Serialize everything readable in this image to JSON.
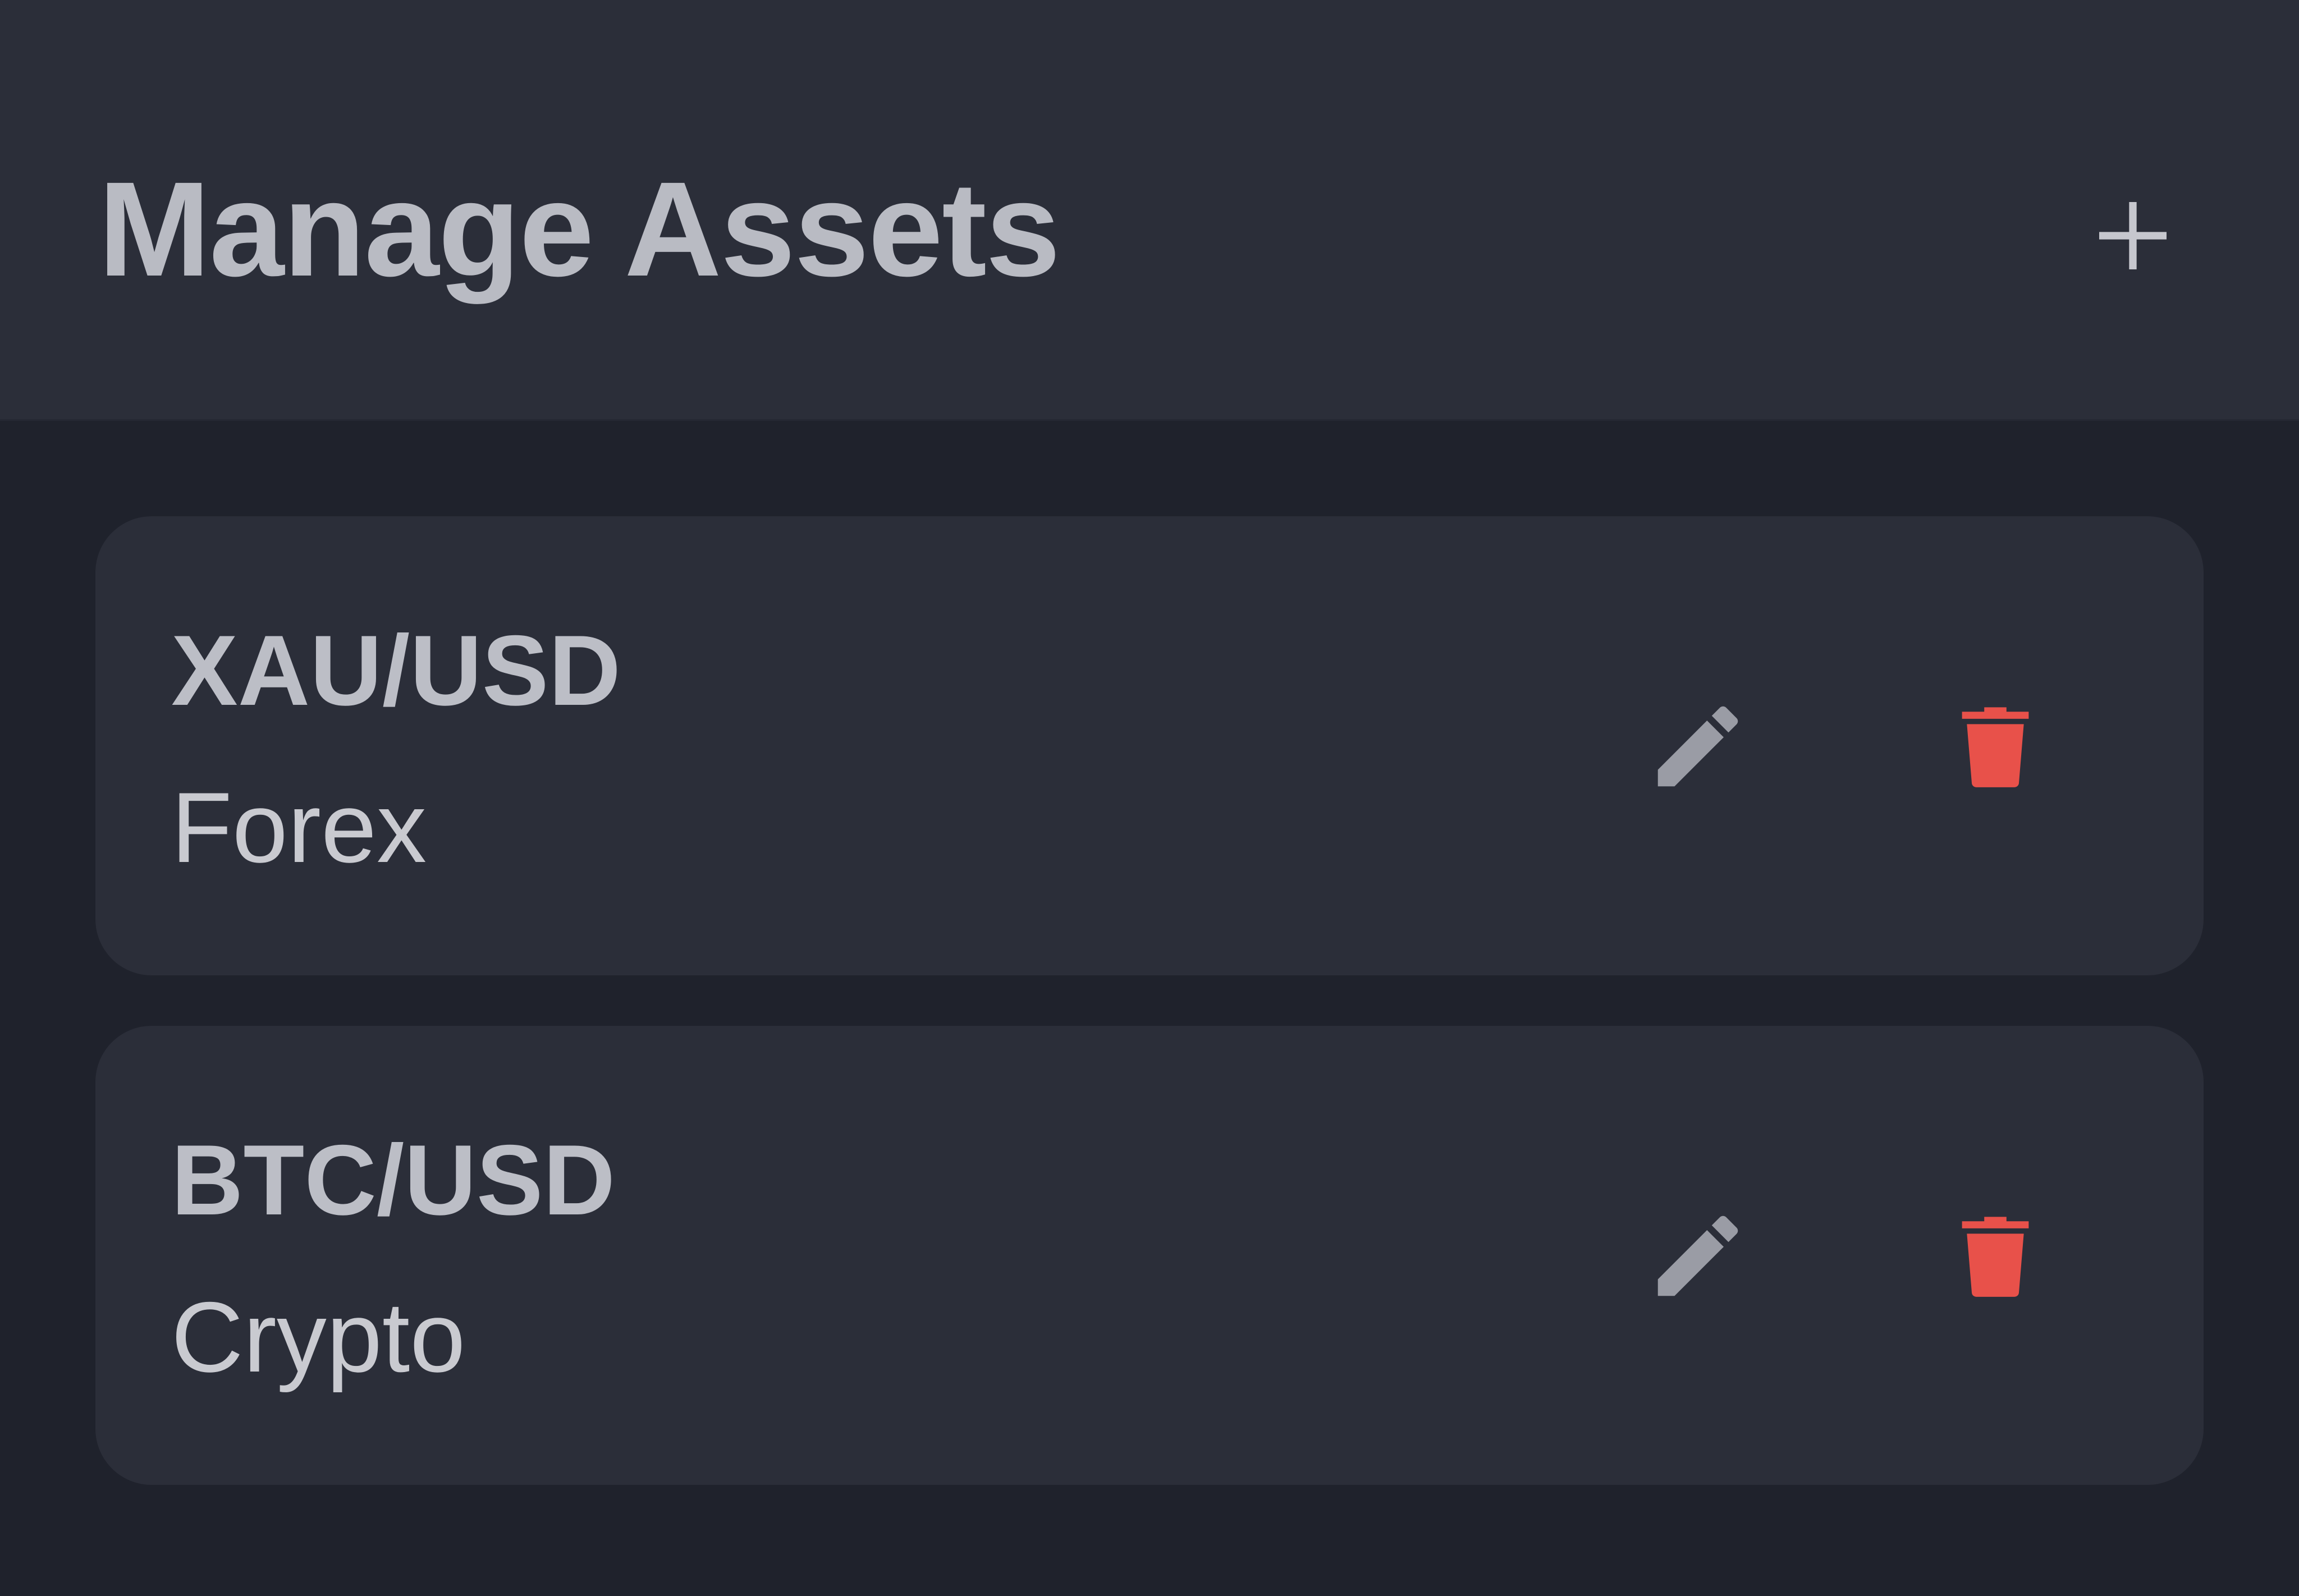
{
  "header": {
    "title": "Manage Assets",
    "add_icon": "plus-icon"
  },
  "colors": {
    "page_background": "#1f222c",
    "surface": "#2b2e39",
    "text_primary": "#bcbec6",
    "icon_muted": "#9a9ca5",
    "danger": "#e8514a"
  },
  "assets": [
    {
      "symbol": "XAU/USD",
      "category": "Forex",
      "edit_icon": "pencil-icon",
      "delete_icon": "trash-icon"
    },
    {
      "symbol": "BTC/USD",
      "category": "Crypto",
      "edit_icon": "pencil-icon",
      "delete_icon": "trash-icon"
    }
  ]
}
